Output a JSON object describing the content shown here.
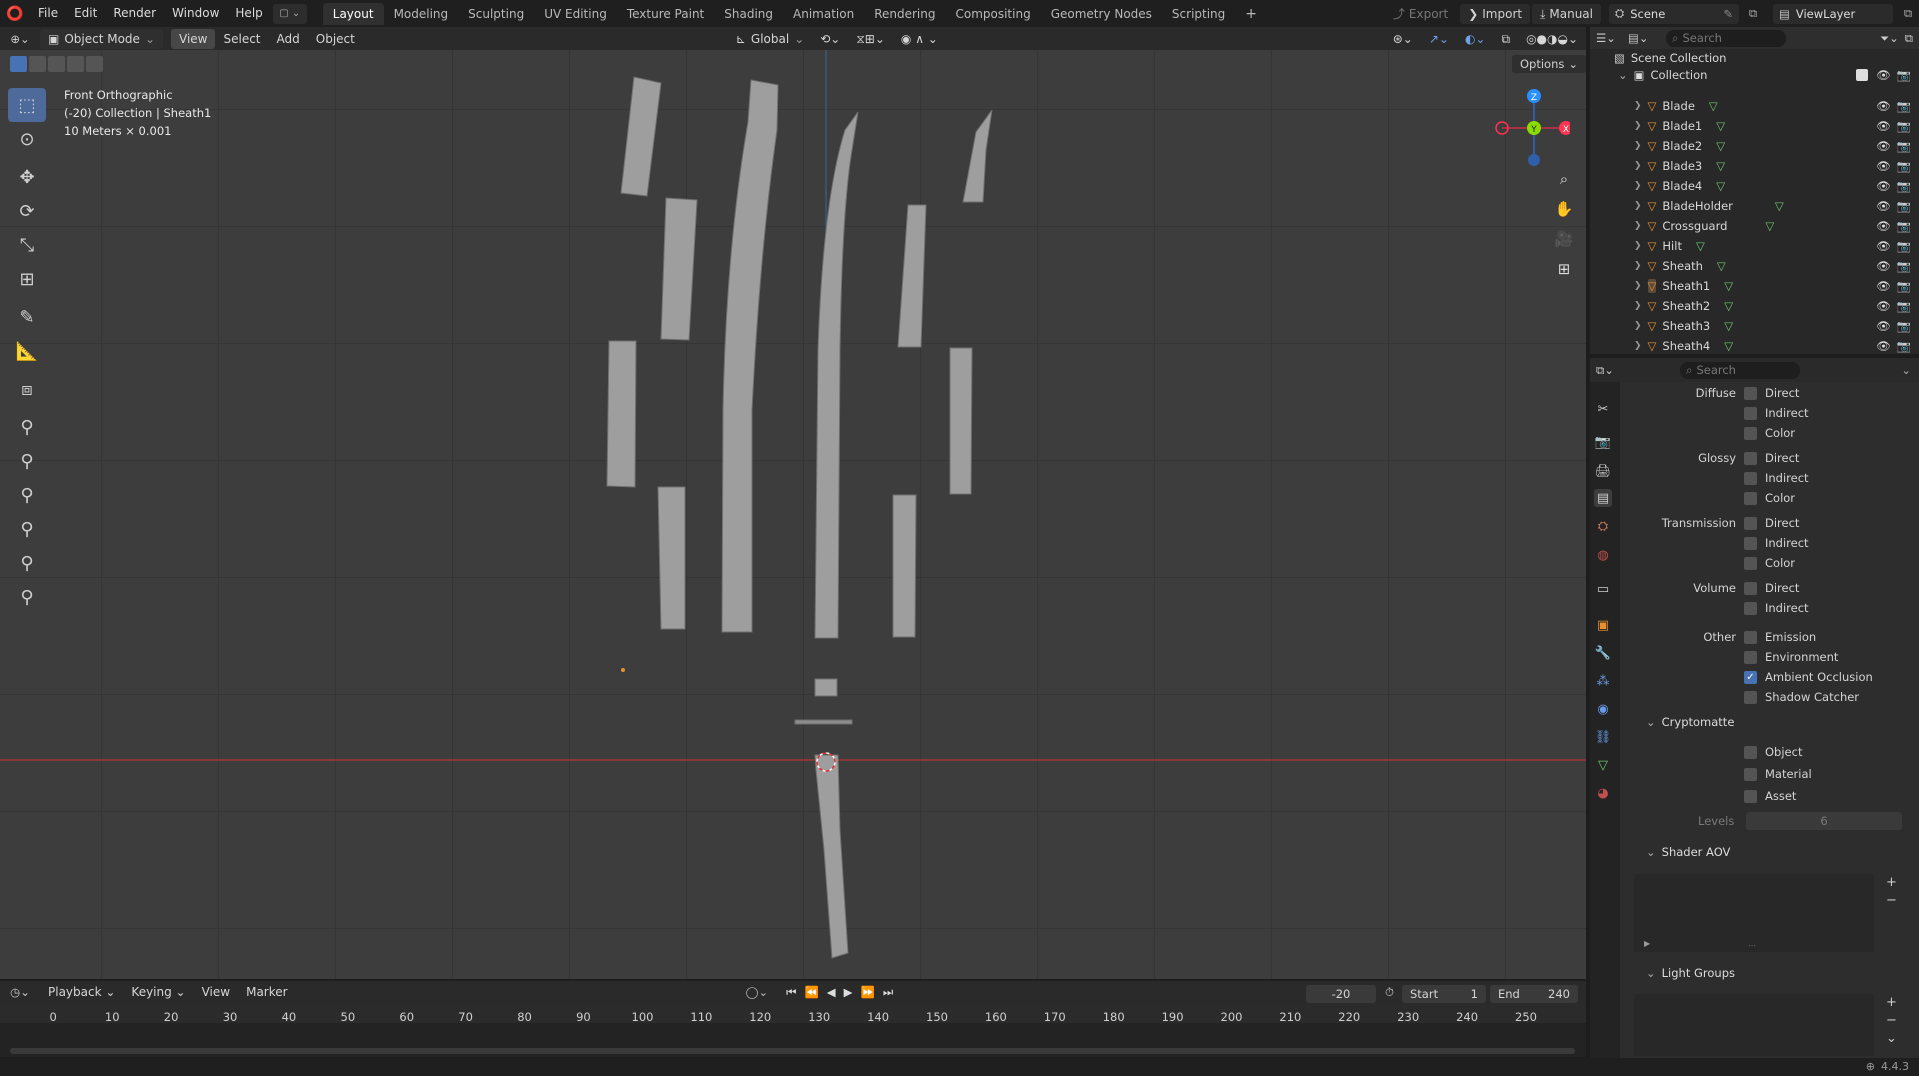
{
  "topbar": {
    "menus": [
      "File",
      "Edit",
      "Render",
      "Window",
      "Help"
    ],
    "workspaces": [
      "Layout",
      "Modeling",
      "Sculpting",
      "UV Editing",
      "Texture Paint",
      "Shading",
      "Animation",
      "Rendering",
      "Compositing",
      "Geometry Nodes",
      "Scripting"
    ],
    "active_workspace": "Layout",
    "add_tab": "+",
    "export_label": "Export",
    "import_label": "Import",
    "manual_label": "Manual",
    "scene_label": "Scene",
    "viewlayer_label": "ViewLayer"
  },
  "viewport_header": {
    "mode": "Object Mode",
    "menus": [
      "View",
      "Select",
      "Add",
      "Object"
    ],
    "orientation": "Global",
    "options_label": "Options"
  },
  "viewport": {
    "view_name": "Front Orthographic",
    "collection_info": "(-20) Collection | Sheath1",
    "scale_info": "10 Meters × 0.001"
  },
  "outliner": {
    "search_placeholder": "Search",
    "scene_collection": "Scene Collection",
    "collection": "Collection",
    "items": [
      "Blade",
      "Blade1",
      "Blade2",
      "Blade3",
      "Blade4",
      "BladeHolder",
      "Crossguard",
      "Hilt",
      "Sheath",
      "Sheath1",
      "Sheath2",
      "Sheath3",
      "Sheath4"
    ],
    "active_item": "Sheath1"
  },
  "properties": {
    "search_placeholder": "Search",
    "groups": [
      {
        "label": "Diffuse",
        "options": [
          "Direct",
          "Indirect",
          "Color"
        ]
      },
      {
        "label": "Glossy",
        "options": [
          "Direct",
          "Indirect",
          "Color"
        ]
      },
      {
        "label": "Transmission",
        "options": [
          "Direct",
          "Indirect",
          "Color"
        ]
      },
      {
        "label": "Volume",
        "options": [
          "Direct",
          "Indirect"
        ]
      },
      {
        "label": "Other",
        "options": [
          "Emission",
          "Environment",
          "Ambient Occlusion",
          "Shadow Catcher"
        ]
      }
    ],
    "checked": [
      "Ambient Occlusion"
    ],
    "cryptomatte": {
      "title": "Cryptomatte",
      "options": [
        "Object",
        "Material",
        "Asset"
      ],
      "levels_label": "Levels",
      "levels_value": "6"
    },
    "shader_aov": {
      "title": "Shader AOV"
    },
    "light_groups": {
      "title": "Light Groups"
    }
  },
  "timeline": {
    "menus": [
      "Playback",
      "Keying",
      "View",
      "Marker"
    ],
    "current_frame": "-20",
    "start_label": "Start",
    "start_value": "1",
    "end_label": "End",
    "end_value": "240",
    "ticks": [
      "0",
      "10",
      "20",
      "30",
      "40",
      "50",
      "60",
      "70",
      "80",
      "90",
      "100",
      "110",
      "120",
      "130",
      "140",
      "150",
      "160",
      "170",
      "180",
      "190",
      "200",
      "210",
      "220",
      "230",
      "240",
      "250"
    ]
  },
  "statusbar": {
    "version": "4.4.3"
  },
  "colors": {
    "accent": "#4772b3",
    "object_orange": "#e8902e",
    "mesh_green": "#6cc56c",
    "x_axis": "#ff3352",
    "y_axis": "#8bdc00",
    "z_axis": "#2890ff"
  }
}
